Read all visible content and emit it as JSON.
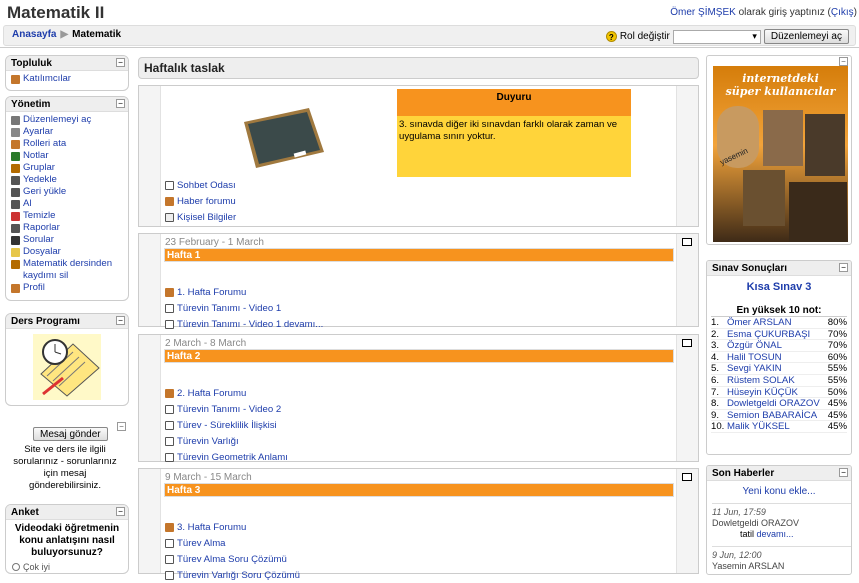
{
  "site_title": "Matematik II",
  "login": {
    "user": "Ömer ŞİMŞEK",
    "text": " olarak giriş yaptınız (",
    "logout": "Çıkış",
    ")": ")"
  },
  "breadcrumb": {
    "home": "Anasayfa",
    "sep": "▶",
    "current": "Matematik"
  },
  "role": {
    "label": "Rol değiştir",
    "select_value": "",
    "edit_button": "Düzenlemeyi aç"
  },
  "left": {
    "topluluk": {
      "title": "Topluluk",
      "items": [
        {
          "label": "Katılımcılar",
          "icon": "people-icon"
        }
      ]
    },
    "yonetim": {
      "title": "Yönetim",
      "items": [
        {
          "label": "Düzenlemeyi aç",
          "icon": "edit-icon"
        },
        {
          "label": "Ayarlar",
          "icon": "settings-icon"
        },
        {
          "label": "Rolleri ata",
          "icon": "roles-icon"
        },
        {
          "label": "Notlar",
          "icon": "grades-icon"
        },
        {
          "label": "Gruplar",
          "icon": "groups-icon"
        },
        {
          "label": "Yedekle",
          "icon": "backup-icon"
        },
        {
          "label": "Geri yükle",
          "icon": "restore-icon"
        },
        {
          "label": "Al",
          "icon": "import-icon"
        },
        {
          "label": "Temizle",
          "icon": "reset-icon"
        },
        {
          "label": "Raporlar",
          "icon": "reports-icon"
        },
        {
          "label": "Sorular",
          "icon": "questions-icon"
        },
        {
          "label": "Dosyalar",
          "icon": "folder-icon"
        },
        {
          "label": "Matematik dersinden kaydımı sil",
          "icon": "unenrol-icon"
        },
        {
          "label": "Profil",
          "icon": "profile-icon"
        }
      ]
    },
    "ders": {
      "title": "Ders Programı"
    },
    "mesaj": {
      "button": "Mesaj gönder",
      "text": "Site ve ders ile ilgili sorularınız - sorunlarınız için mesaj gönderebilirsiniz."
    },
    "anket": {
      "title": "Anket",
      "question": "Videodaki öğretmenin konu anlatışını nasıl buluyorsunuz?",
      "option": "Çok iyi"
    }
  },
  "main": {
    "title": "Haftalık taslak",
    "duyuru": {
      "title": "Duyuru",
      "text": "3. sınavda diğer iki sınavdan farklı olarak zaman ve uygulama sınırı yoktur."
    },
    "top_links": [
      "Sohbet Odası",
      "Haber forumu",
      "Kişisel Bilgiler"
    ],
    "weeks": [
      {
        "date": "23 February - 1 March",
        "title": "Hafta 1",
        "items": [
          "1. Hafta Forumu",
          "Türevin Tanımı - Video 1",
          "Türevin Tanımı - Video 1 devamı..."
        ]
      },
      {
        "date": "2 March - 8 March",
        "title": "Hafta 2",
        "items": [
          "2. Hafta Forumu",
          "Türevin Tanımı - Video 2",
          "Türev - Süreklilik İlişkisi",
          "Türevin Varlığı",
          "Türevin Geometrik Anlamı"
        ]
      },
      {
        "date": "9 March - 15 March",
        "title": "Hafta 3",
        "items": [
          "3. Hafta Forumu",
          "Türev Alma",
          "Türev Alma Soru Çözümü",
          "Türevin Varlığı Soru Çözümü"
        ]
      }
    ]
  },
  "right": {
    "image_text1": "internetdeki",
    "image_text2": "süper kullanıcılar",
    "image_text3": "yasemin",
    "sinav": {
      "title": "Sınav Sonuçları",
      "quiz": "Kısa Sınav 3",
      "subtitle": "En yüksek 10 not:",
      "rows": [
        {
          "n": "1.",
          "name": "Ömer ARSLAN",
          "score": "80%"
        },
        {
          "n": "2.",
          "name": "Esma ÇUKURBAŞI",
          "score": "70%"
        },
        {
          "n": "3.",
          "name": "Özgür ÖNAL",
          "score": "70%"
        },
        {
          "n": "4.",
          "name": "Halil TOSUN",
          "score": "60%"
        },
        {
          "n": "5.",
          "name": "Sevgi YAKIN",
          "score": "55%"
        },
        {
          "n": "6.",
          "name": "Rüstem SOLAK",
          "score": "55%"
        },
        {
          "n": "7.",
          "name": "Hüseyin KÜÇÜK",
          "score": "50%"
        },
        {
          "n": "8.",
          "name": "Dowletgeldi ORAZOV",
          "score": "45%"
        },
        {
          "n": "9.",
          "name": "Semion BABARAİCA",
          "score": "45%"
        },
        {
          "n": "10.",
          "name": "Malik YÜKSEL",
          "score": "45%"
        }
      ]
    },
    "haber": {
      "title": "Son Haberler",
      "add": "Yeni konu ekle...",
      "posts": [
        {
          "date": "11 Jun, 17:59",
          "author": "Dowletgeldi ORAZOV",
          "subject": "tatil",
          "more": "devamı..."
        },
        {
          "date": "9 Jun, 12:00",
          "author": "Yasemin ARSLAN"
        }
      ]
    }
  }
}
